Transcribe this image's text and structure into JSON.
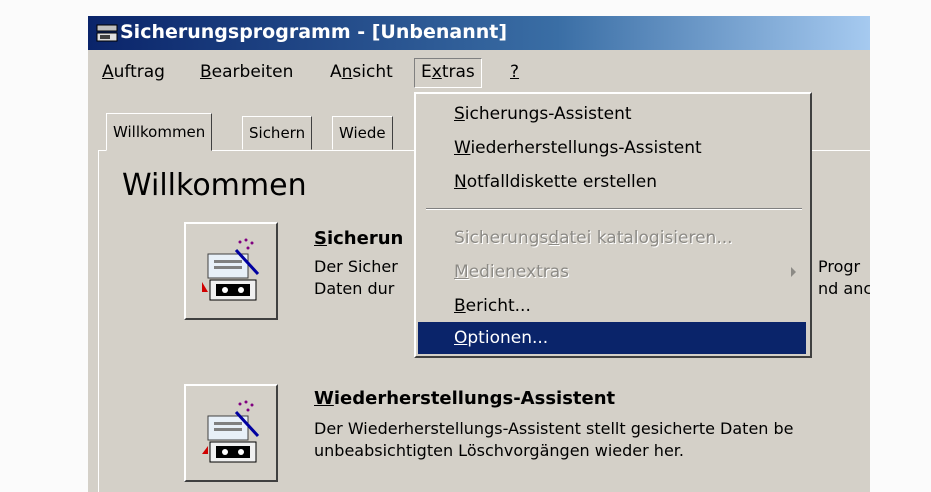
{
  "window": {
    "title": "Sicherungsprogramm - [Unbenannt]",
    "icon": "backup-app-icon"
  },
  "menubar": {
    "items": [
      {
        "acc": "A",
        "rest": "uftrag"
      },
      {
        "acc": "B",
        "rest": "earbeiten"
      },
      {
        "pre": "A",
        "acc": "n",
        "rest": "sicht"
      },
      {
        "pre": "E",
        "acc": "x",
        "rest": "tras",
        "open": true
      },
      {
        "acc": "?",
        "rest": ""
      }
    ]
  },
  "tabs": [
    {
      "label": "Willkommen",
      "active": true
    },
    {
      "label": "Sichern"
    },
    {
      "label": "Wiede"
    }
  ],
  "welcome": {
    "heading": "Willkommen",
    "features": [
      {
        "title": "Sicherun",
        "line1": "Der Sicher",
        "line2": "Daten dur",
        "icon": "backup-wizard-icon"
      },
      {
        "title": "Wiederherstellungs-Assistent",
        "line1": "Der Wiederherstellungs-Assistent stellt gesicherte Daten be",
        "line2": "unbeabsichtigten Löschvorgängen wieder her.",
        "icon": "restore-wizard-icon"
      }
    ],
    "clipped_right": [
      "Progr",
      "nd anc"
    ]
  },
  "extras_menu": {
    "items": [
      {
        "acc": "S",
        "rest": "icherungs-Assistent"
      },
      {
        "acc": "W",
        "rest": "iederherstellungs-Assistent"
      },
      {
        "acc": "N",
        "rest": "otfalldiskette erstellen"
      },
      {
        "pre": "Sicherungs",
        "acc": "d",
        "rest": "atei katalogisieren...",
        "disabled": true
      },
      {
        "acc": "M",
        "rest": "edienextras",
        "disabled": true,
        "submenu": true
      },
      {
        "acc": "B",
        "rest": "ericht..."
      },
      {
        "acc": "O",
        "rest": "ptionen...",
        "highlighted": true
      }
    ]
  },
  "colors": {
    "title_bar": "#0a246a",
    "highlight": "#0a246a",
    "face": "#d4d0c8"
  }
}
